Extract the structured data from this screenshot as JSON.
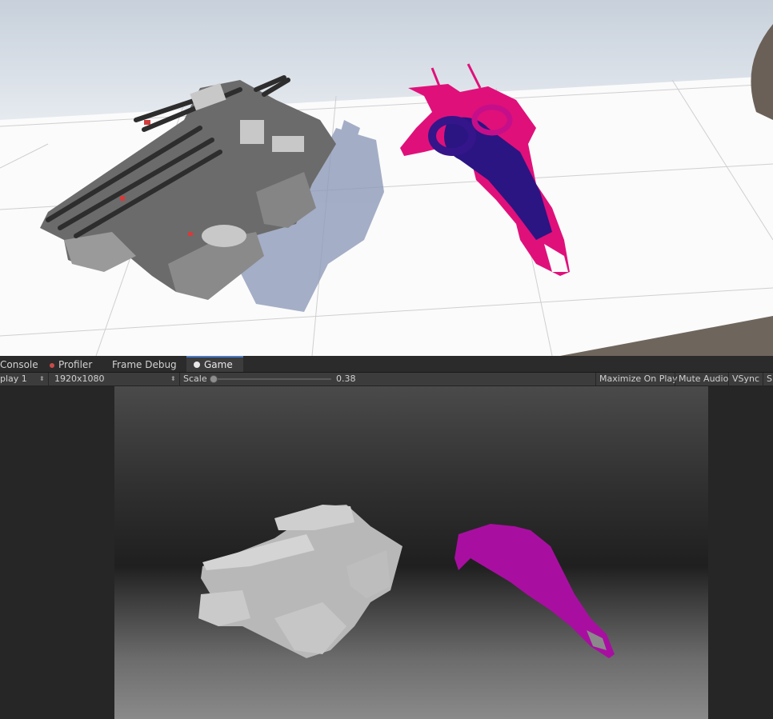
{
  "tabs": [
    {
      "label": "Console",
      "icon": "console-icon"
    },
    {
      "label": "Profiler",
      "icon": "profiler-icon"
    },
    {
      "label": "Frame Debug",
      "icon": ""
    },
    {
      "label": "Game",
      "icon": "game-icon",
      "active": true
    }
  ],
  "toolbar": {
    "display": "play 1",
    "resolution": "1920x1080",
    "scale_label": "Scale",
    "scale_value": "0.38",
    "maximize_on_play": "Maximize On Play",
    "mute_audio": "Mute Audio",
    "vsync": "VSync",
    "stats_truncated": "S"
  },
  "colors": {
    "magenta_mesh": "#e0107a",
    "depth_magenta": "#a80fa0",
    "active_tab_accent": "#4a79c5"
  }
}
